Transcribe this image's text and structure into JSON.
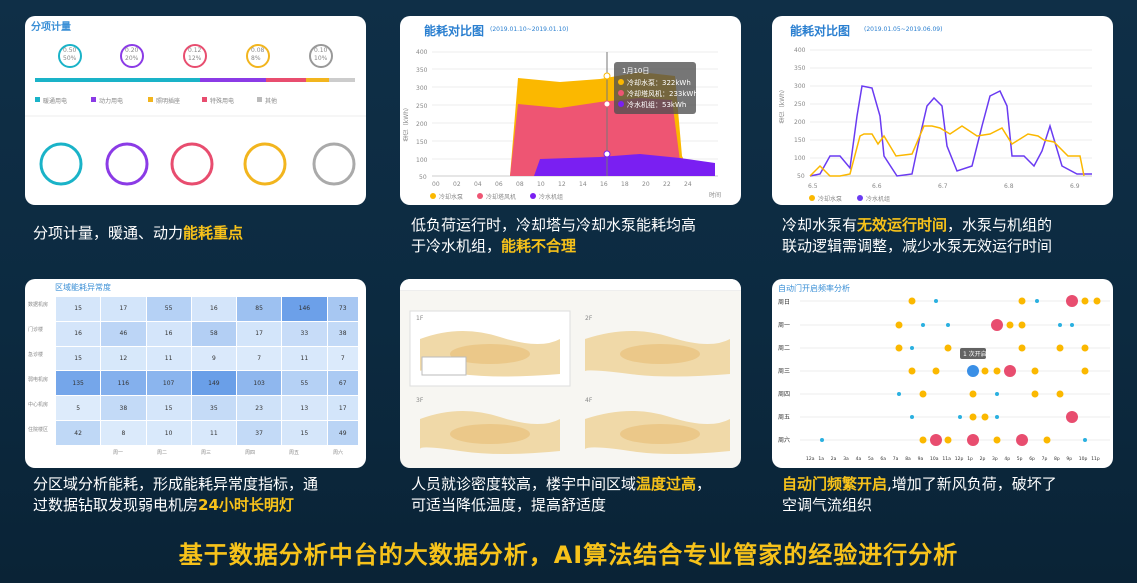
{
  "panels": {
    "p1": {
      "title": "分项计量",
      "rings": [
        "0.50\n50%",
        "0.20\n20%",
        "0.12\n12%",
        "0.08\n8%",
        "0.10\n10%"
      ],
      "ring_top": [
        {
          "v": "0.50",
          "p": "50%"
        },
        {
          "v": "0.20",
          "p": "20%"
        },
        {
          "v": "0.12",
          "p": "12%"
        },
        {
          "v": "0.08",
          "p": "8%"
        },
        {
          "v": "0.10",
          "p": "10%"
        }
      ],
      "legend": [
        "暖通用电",
        "动力用电",
        "照明插座",
        "特殊用电",
        "其他"
      ],
      "caption_pre": "分项计量，暖通、动力",
      "caption_hl": "能耗重点"
    },
    "p2": {
      "title": "能耗对比图",
      "date_range": "(2019.01.10~2019.01.10)",
      "yaxis_label": "单位（kWh）",
      "tooltip_title": "1月10日",
      "tooltip_rows": [
        "冷却水泵：322kWh",
        "冷却塔风机：233kWh",
        "冷水机组：53kWh"
      ],
      "x_label": "时间",
      "legend": [
        "冷却水泵",
        "冷却塔风机",
        "冷水机组"
      ],
      "caption_line1": "低负荷运行时，冷却塔与冷却水泵能耗均高",
      "caption_line2_pre": "于冷水机组，",
      "caption_line2_hl": "能耗不合理"
    },
    "p3": {
      "title": "能耗对比图",
      "date_range": "(2019.01.05~2019.06.09)",
      "yaxis_label": "单位（kWh）",
      "legend": [
        "冷却水泵",
        "冷水机组"
      ],
      "caption_line1_pre": "冷却水泵有",
      "caption_line1_hl": "无效运行时间",
      "caption_line1_post": "，水泵与机组的",
      "caption_line2": "联动逻辑需调整，减少水泵无效运行时间"
    },
    "p4": {
      "title": "区域能耗异常度",
      "row_labels": [
        "数据机房",
        "门诊楼",
        "急诊楼",
        "弱电机房",
        "中心机房",
        "住院楼区"
      ],
      "rows": [
        [
          "15",
          "17",
          "55",
          "16",
          "85",
          "146",
          "73"
        ],
        [
          "16",
          "46",
          "16",
          "58",
          "17",
          "33",
          "38"
        ],
        [
          "15",
          "12",
          "11",
          "9",
          "7",
          "11",
          "7"
        ],
        [
          "135",
          "116",
          "107",
          "149",
          "103",
          "55",
          "67"
        ],
        [
          "5",
          "38",
          "15",
          "35",
          "23",
          "13",
          "17"
        ],
        [
          "42",
          "8",
          "10",
          "11",
          "37",
          "15",
          "49"
        ]
      ],
      "col_labels": [
        "周一",
        "周二",
        "周三",
        "周四",
        "周五",
        "周六"
      ],
      "caption_line1": "分区域分析能耗，形成能耗异常度指标，通",
      "caption_line2_pre": "过数据钻取发现弱电机房",
      "caption_line2_hl": "24小时长明灯"
    },
    "p5": {
      "floors": [
        "1F",
        "2F",
        "3F",
        "4F"
      ],
      "caption_line1_pre": "人员就诊密度较高，楼宇中间区域",
      "caption_line1_hl": "温度过高",
      "caption_line1_post": "，",
      "caption_line2": "可适当降低温度，提高舒适度"
    },
    "p6": {
      "title": "自动门开启频率分析",
      "days": [
        "周日",
        "周一",
        "周二",
        "周三",
        "周四",
        "周五",
        "周六"
      ],
      "hours": [
        "12a",
        "1a",
        "2a",
        "3a",
        "4a",
        "5a",
        "6a",
        "7a",
        "8a",
        "9a",
        "10a",
        "11a",
        "12p",
        "1p",
        "2p",
        "3p",
        "4p",
        "5p",
        "6p",
        "7p",
        "8p",
        "9p",
        "10p",
        "11p"
      ],
      "tooltip": "1 次开启",
      "caption_line1_hl": "自动门频繁开启",
      "caption_line1_post": ",增加了新风负荷，破坏了",
      "caption_line2": "空调气流组织"
    }
  },
  "footer": "基于数据分析中台的大数据分析，AI算法结合专业管家的经验进行分析",
  "colors": {
    "accent": "#f7c21a",
    "orange": "#fbb800",
    "pink": "#e84d6f",
    "purple": "#7a1ff2",
    "blue": "#3a8fd6"
  }
}
